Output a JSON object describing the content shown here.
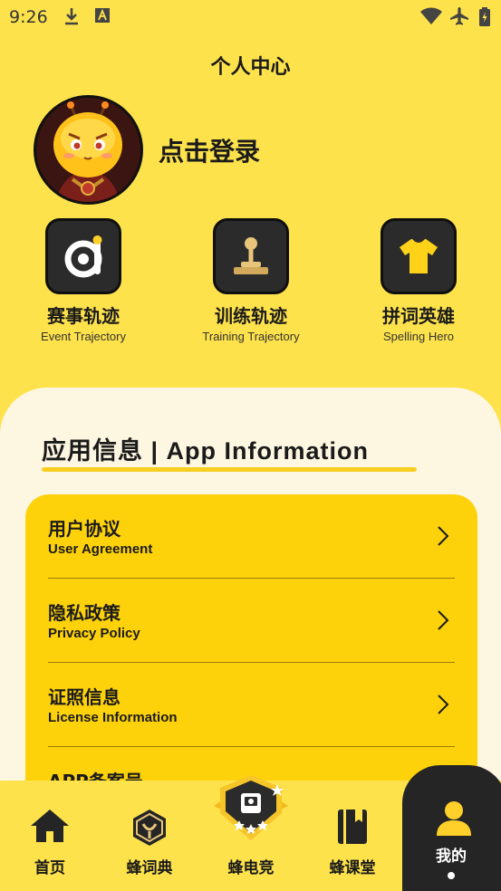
{
  "status_bar": {
    "time": "9:26",
    "icons": [
      "download-icon",
      "font-icon",
      "wifi-icon",
      "airplane-icon",
      "battery-icon"
    ]
  },
  "header": {
    "title": "个人中心"
  },
  "profile": {
    "login_label": "点击登录"
  },
  "quick_actions": [
    {
      "label": "赛事轨迹",
      "sub": "Event Trajectory",
      "icon": "event-icon"
    },
    {
      "label": "训练轨迹",
      "sub": "Training Trajectory",
      "icon": "joystick-icon"
    },
    {
      "label": "拼词英雄",
      "sub": "Spelling Hero",
      "icon": "tshirt-icon"
    }
  ],
  "app_info": {
    "section_title": "应用信息 | App Information",
    "items": [
      {
        "title": "用户协议",
        "sub": "User Agreement"
      },
      {
        "title": "隐私政策",
        "sub": "Privacy Policy"
      },
      {
        "title": "证照信息",
        "sub": "License Information"
      },
      {
        "title": "APP备案号",
        "sub": ""
      }
    ]
  },
  "bottom_nav": [
    {
      "label": "首页",
      "icon": "home-icon"
    },
    {
      "label": "蜂词典",
      "icon": "dictionary-icon"
    },
    {
      "label": "蜂电竞",
      "icon": "esports-icon"
    },
    {
      "label": "蜂课堂",
      "icon": "book-icon"
    },
    {
      "label": "我的",
      "icon": "person-icon",
      "active": true
    }
  ],
  "colors": {
    "background": "#fde24b",
    "panel": "#fdf6e1",
    "card": "#fed20b",
    "dark": "#252525"
  }
}
